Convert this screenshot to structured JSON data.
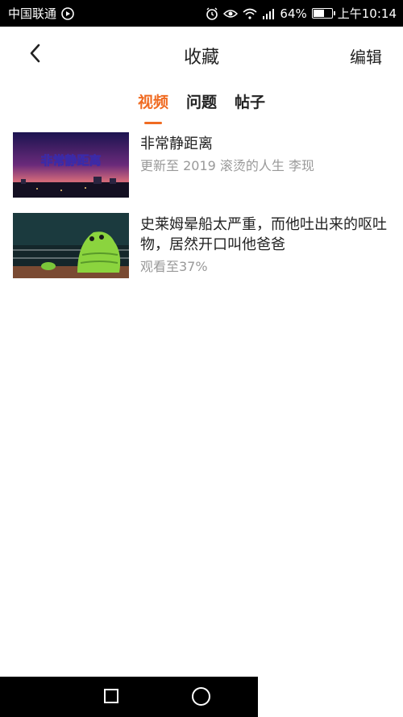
{
  "status_bar": {
    "carrier": "中国联通",
    "battery": "64%",
    "battery_level": 0.64,
    "time": "上午10:14",
    "icons": [
      "video-icon",
      "alarm-icon",
      "eye-icon",
      "wifi-icon",
      "signal-icon",
      "battery-icon"
    ]
  },
  "header": {
    "back_icon": "chevron-left-icon",
    "title": "收藏",
    "edit_label": "编辑"
  },
  "tabs": [
    {
      "label": "视频",
      "active": true
    },
    {
      "label": "问题",
      "active": false
    },
    {
      "label": "帖子",
      "active": false
    }
  ],
  "items": [
    {
      "title": "非常静距离",
      "subtitle": "更新至 2019 滚烫的人生 李现",
      "thumb_text": "非常静距离"
    },
    {
      "title": "史莱姆晕船太严重，而他吐出来的呕吐物，居然开口叫他爸爸",
      "subtitle": "观看至37%"
    }
  ],
  "colors": {
    "accent": "#f06b22",
    "text": "#222222",
    "subtext": "#999999"
  }
}
